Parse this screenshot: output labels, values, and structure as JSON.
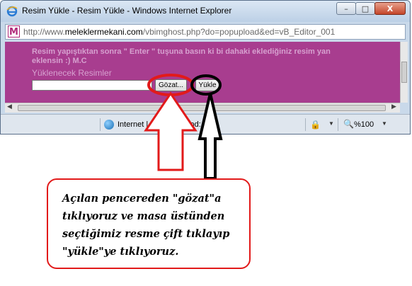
{
  "window": {
    "title": "Resim Yükle - Resim Yükle - Windows Internet Explorer",
    "min_label": "–",
    "max_label": "□",
    "close_label": "X"
  },
  "address": {
    "prefix": "http://www.",
    "domain": "meleklermekani.com",
    "path": "/vbimghost.php?do=popupload&ed=vB_Editor_001",
    "icon_letter": "M"
  },
  "content": {
    "message_line1": "Resim yapıştıktan sonra \" Enter \" tuşuna basın ki bi dahaki eklediğiniz resim yan",
    "message_line2": "eklensin :) M.C",
    "upload_label": "Yüklenecek Resimler",
    "browse_button": "Gözat...",
    "upload_button": "Yükle",
    "file_value": ""
  },
  "statusbar": {
    "zone_text": "Internet | Korumalı Mod: Açık",
    "zoom": "%100"
  },
  "annotation": {
    "callout_text": "Açılan pencereden \"gözat\"a tıklıyoruz ve masa üstünden seçtiğimiz resme çift tıklayıp \"yükle\"ye tıklıyoruz."
  },
  "colors": {
    "content_bg": "#a83d8f",
    "highlight_red": "#e21a1a",
    "highlight_black": "#000000"
  }
}
